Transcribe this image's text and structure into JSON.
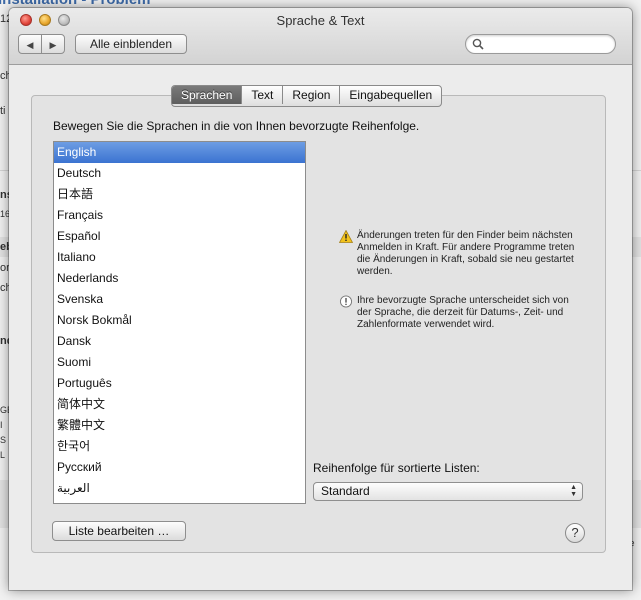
{
  "background_app": {
    "title": "Installation - Problem",
    "fragments": [
      "12",
      "ch",
      "ti",
      "ns",
      "16",
      "eb",
      "or",
      "ch",
      "nd",
      "GB",
      "I",
      "S",
      "L",
      "tzte"
    ]
  },
  "window": {
    "title": "Sprache & Text",
    "show_all_label": "Alle einblenden",
    "back_symbol": "◀",
    "forward_symbol": "▶",
    "search_placeholder": ""
  },
  "tabs": [
    {
      "label": "Sprachen",
      "active": true
    },
    {
      "label": "Text",
      "active": false
    },
    {
      "label": "Region",
      "active": false
    },
    {
      "label": "Eingabequellen",
      "active": false
    }
  ],
  "instruction": "Bewegen Sie die Sprachen in die von Ihnen bevorzugte Reihenfolge.",
  "languages": [
    "English",
    "Deutsch",
    "日本語",
    "Français",
    "Español",
    "Italiano",
    "Nederlands",
    "Svenska",
    "Norsk Bokmål",
    "Dansk",
    "Suomi",
    "Português",
    "简体中文",
    "繁體中文",
    "한국어",
    "Русский",
    "العربية"
  ],
  "selected_language": "English",
  "notices": {
    "warning": "Änderungen treten für den Finder beim nächsten Anmelden in Kraft. Für andere Programme treten die Änderungen in Kraft, sobald sie neu gestartet werden.",
    "info": "Ihre bevorzugte Sprache unterscheidet sich von der Sprache, die derzeit für Datums-, Zeit- und Zahlenformate verwendet wird."
  },
  "sort": {
    "label": "Reihenfolge für sortierte Listen:",
    "value": "Standard"
  },
  "buttons": {
    "edit_list": "Liste bearbeiten …",
    "help": "?"
  },
  "colors": {
    "selection": "#3b73d1",
    "active_tab": "#5e5e5e",
    "warning_icon": "#f2c21b"
  }
}
